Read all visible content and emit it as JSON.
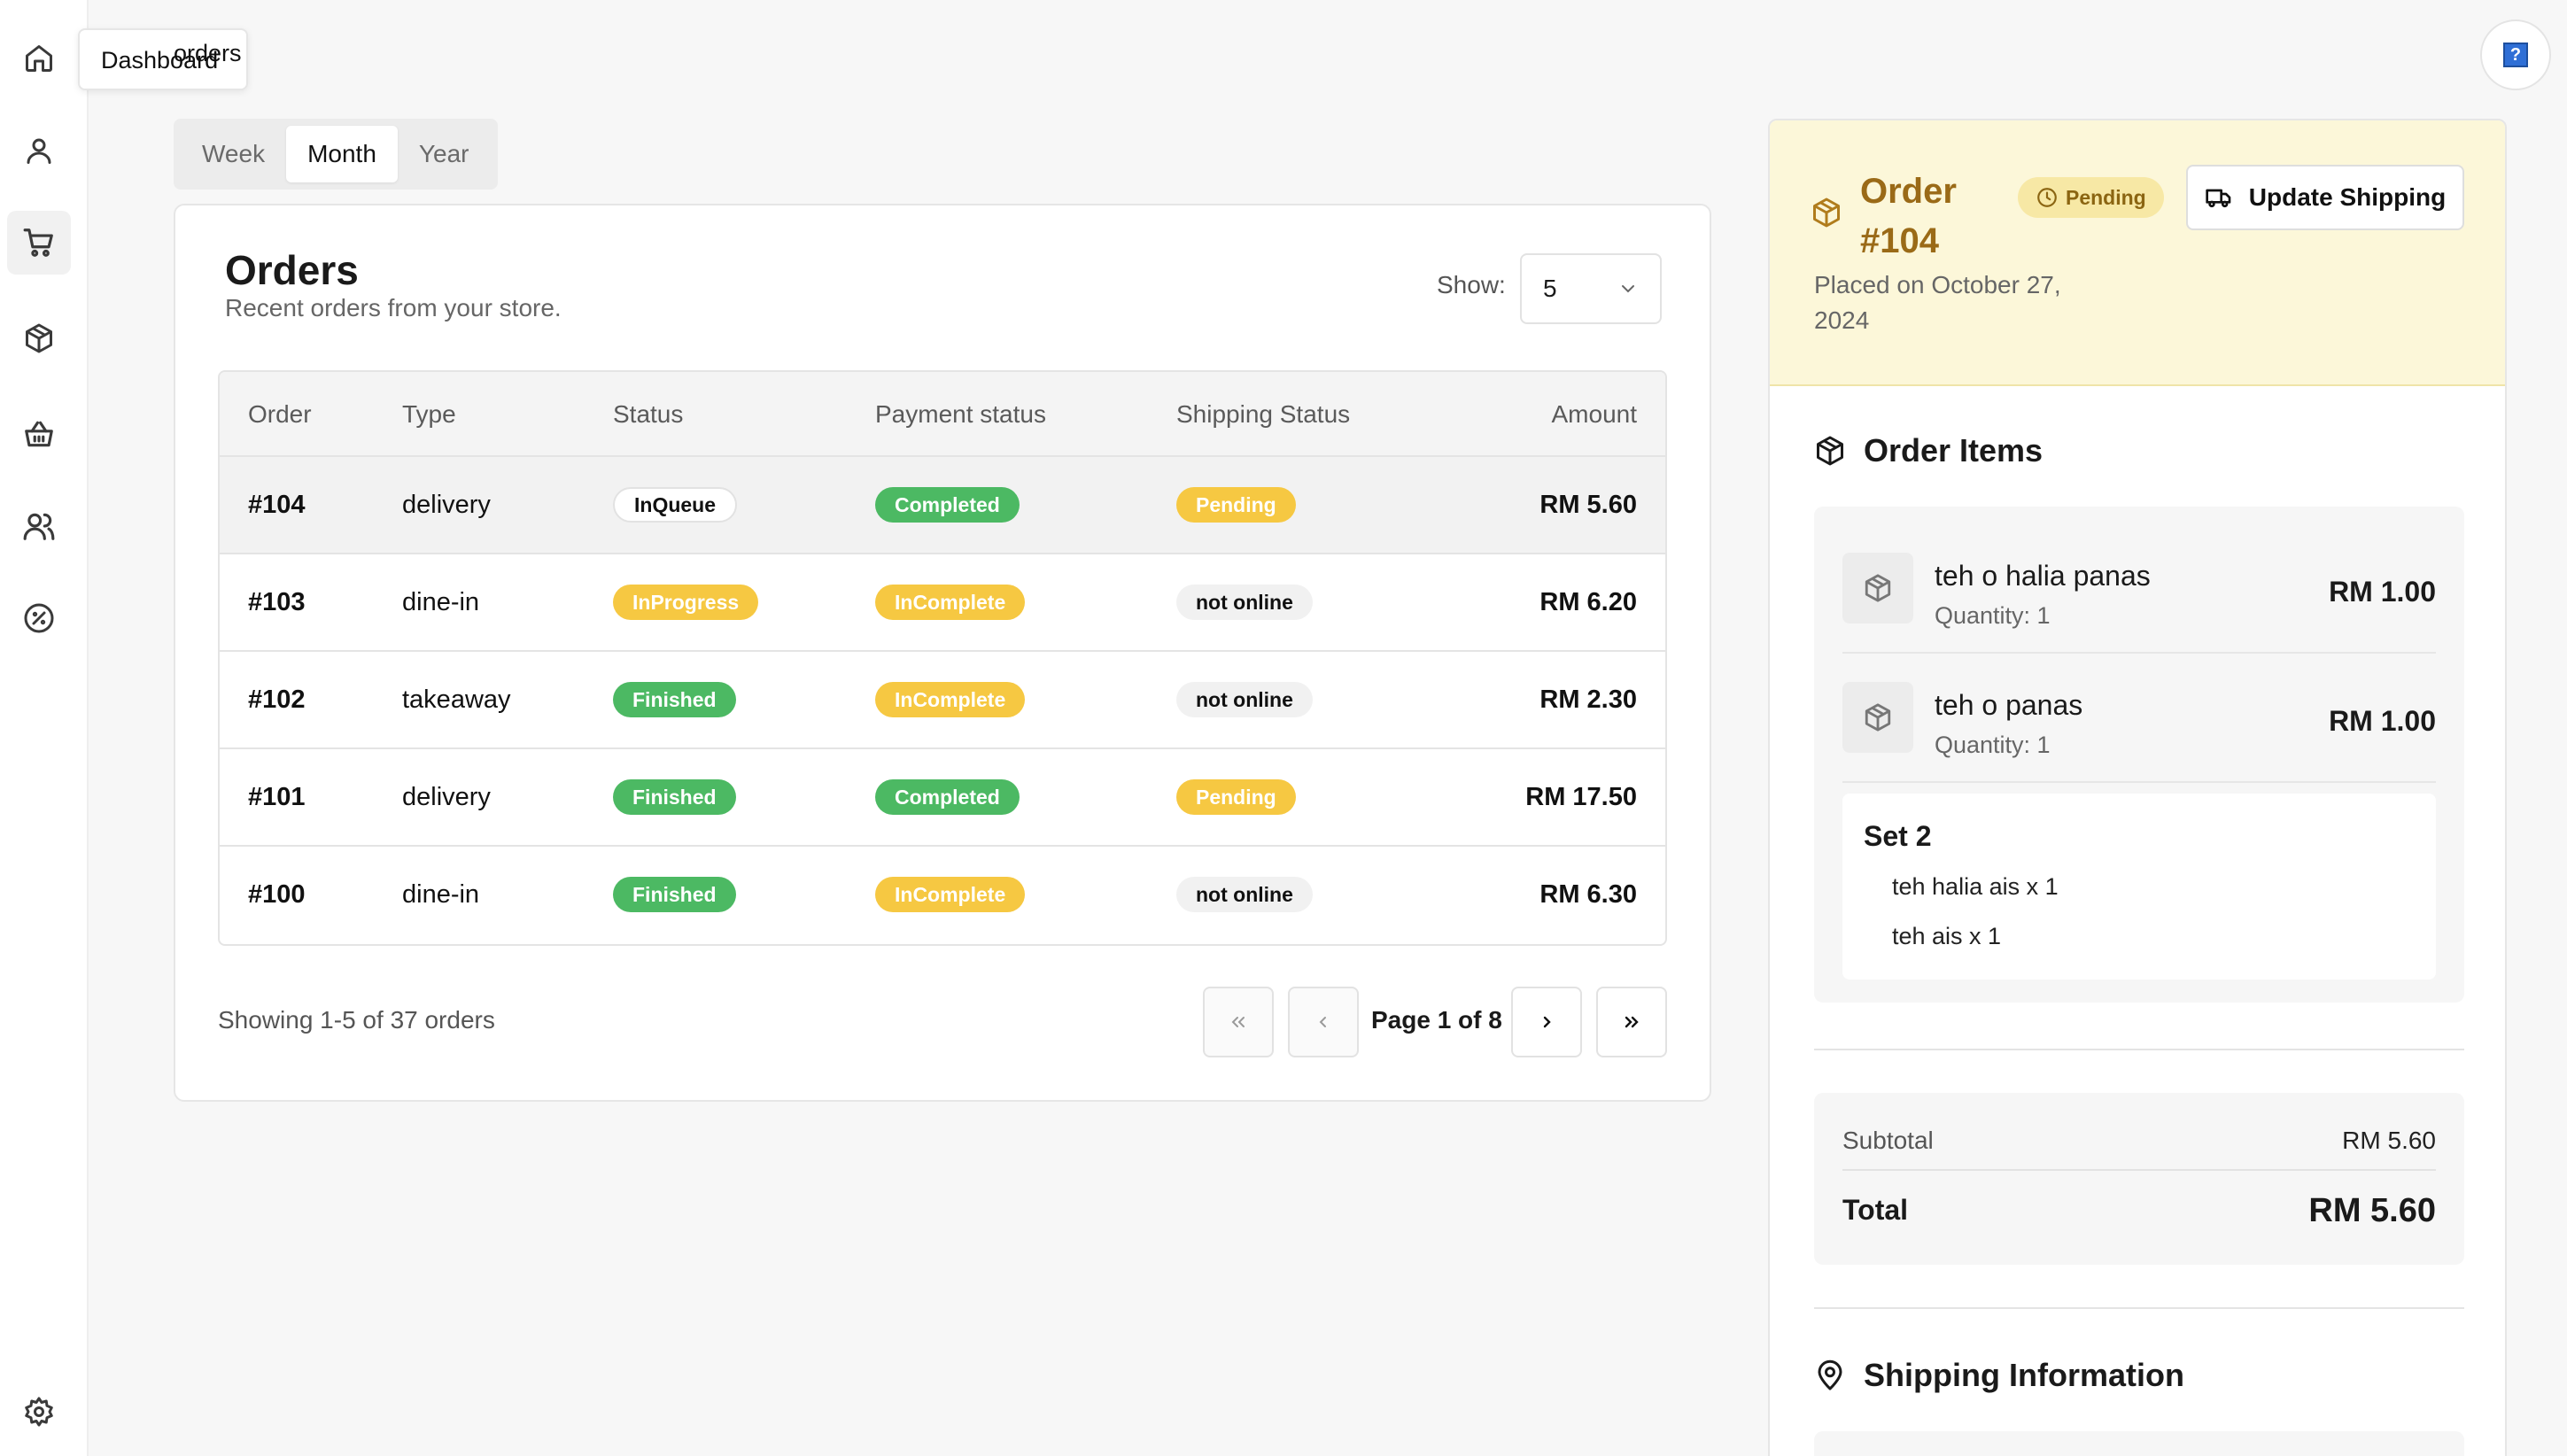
{
  "tooltip": {
    "text_a": "Dashboard",
    "text_b": "orders"
  },
  "sidebar": {
    "items": [
      {
        "name": "home-icon"
      },
      {
        "name": "user-icon"
      },
      {
        "name": "cart-icon",
        "active": true
      },
      {
        "name": "package-icon"
      },
      {
        "name": "basket-icon"
      },
      {
        "name": "users-icon"
      },
      {
        "name": "discount-icon"
      },
      {
        "name": "gear-icon"
      }
    ]
  },
  "period_tabs": [
    "Week",
    "Month",
    "Year"
  ],
  "period_active": "Month",
  "orders": {
    "title": "Orders",
    "subtitle": "Recent orders from your store.",
    "show_label": "Show:",
    "show_value": "5",
    "columns": [
      "Order",
      "Type",
      "Status",
      "Payment status",
      "Shipping Status",
      "Amount"
    ],
    "rows": [
      {
        "order": "#104",
        "type": "delivery",
        "status": "InQueue",
        "payment": "Completed",
        "shipping": "Pending",
        "amount": "RM 5.60"
      },
      {
        "order": "#103",
        "type": "dine-in",
        "status": "InProgress",
        "payment": "InComplete",
        "shipping": "not online",
        "amount": "RM 6.20"
      },
      {
        "order": "#102",
        "type": "takeaway",
        "status": "Finished",
        "payment": "InComplete",
        "shipping": "not online",
        "amount": "RM 2.30"
      },
      {
        "order": "#101",
        "type": "delivery",
        "status": "Finished",
        "payment": "Completed",
        "shipping": "Pending",
        "amount": "RM 17.50"
      },
      {
        "order": "#100",
        "type": "dine-in",
        "status": "Finished",
        "payment": "InComplete",
        "shipping": "not online",
        "amount": "RM 6.30"
      }
    ],
    "showing": "Showing 1-5 of 37 orders",
    "page_label": "Page 1 of 8"
  },
  "detail": {
    "order_title": "Order #104",
    "status": "Pending",
    "update_button": "Update Shipping",
    "placed": "Placed on October 27, 2024",
    "items_title": "Order Items",
    "items": [
      {
        "name": "teh o halia panas",
        "qty": "Quantity: 1",
        "price": "RM 1.00"
      },
      {
        "name": "teh o panas",
        "qty": "Quantity: 1",
        "price": "RM 1.00"
      }
    ],
    "set": {
      "title": "Set 2",
      "items": [
        "teh halia ais x 1",
        "teh ais x 1"
      ]
    },
    "subtotal_label": "Subtotal",
    "subtotal_value": "RM 5.60",
    "total_label": "Total",
    "total_value": "RM 5.60",
    "shipping_title": "Shipping Information"
  },
  "colors": {
    "green": "#4cb963",
    "yellow": "#f6c842",
    "header_bg": "#fcf7d9",
    "order_title": "#9a6a17"
  }
}
